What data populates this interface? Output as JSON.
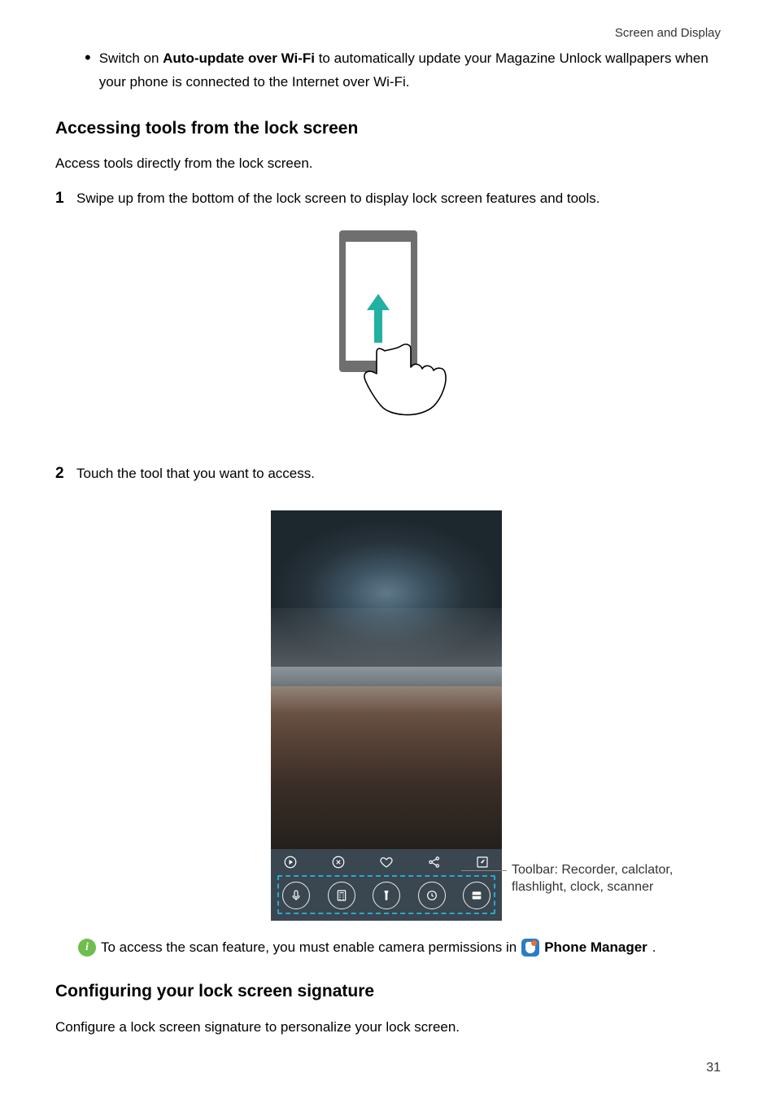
{
  "header": {
    "section": "Screen and Display"
  },
  "bullet": {
    "prefix": "Switch on ",
    "bold": "Auto-update over Wi-Fi",
    "suffix": " to automatically update your Magazine Unlock wallpapers when your phone is connected to the Internet over Wi-Fi."
  },
  "section1": {
    "title": "Accessing tools from the lock screen",
    "intro": "Access tools directly from the lock screen.",
    "step1": "Swipe up from the bottom of the lock screen to display lock screen features and tools.",
    "step2": "Touch the tool that you want to access."
  },
  "callout": {
    "line1": "Toolbar: Recorder, calclator,",
    "line2": "flashlight, clock, scanner"
  },
  "note": {
    "prefix": "To access the scan feature, you must enable camera permissions in ",
    "app": "Phone Manager",
    "suffix": "."
  },
  "section2": {
    "title": "Configuring your lock screen signature",
    "intro": "Configure a lock screen signature to personalize your lock screen."
  },
  "pageNumber": "31",
  "stepNums": {
    "one": "1",
    "two": "2"
  },
  "infoGlyph": "i"
}
